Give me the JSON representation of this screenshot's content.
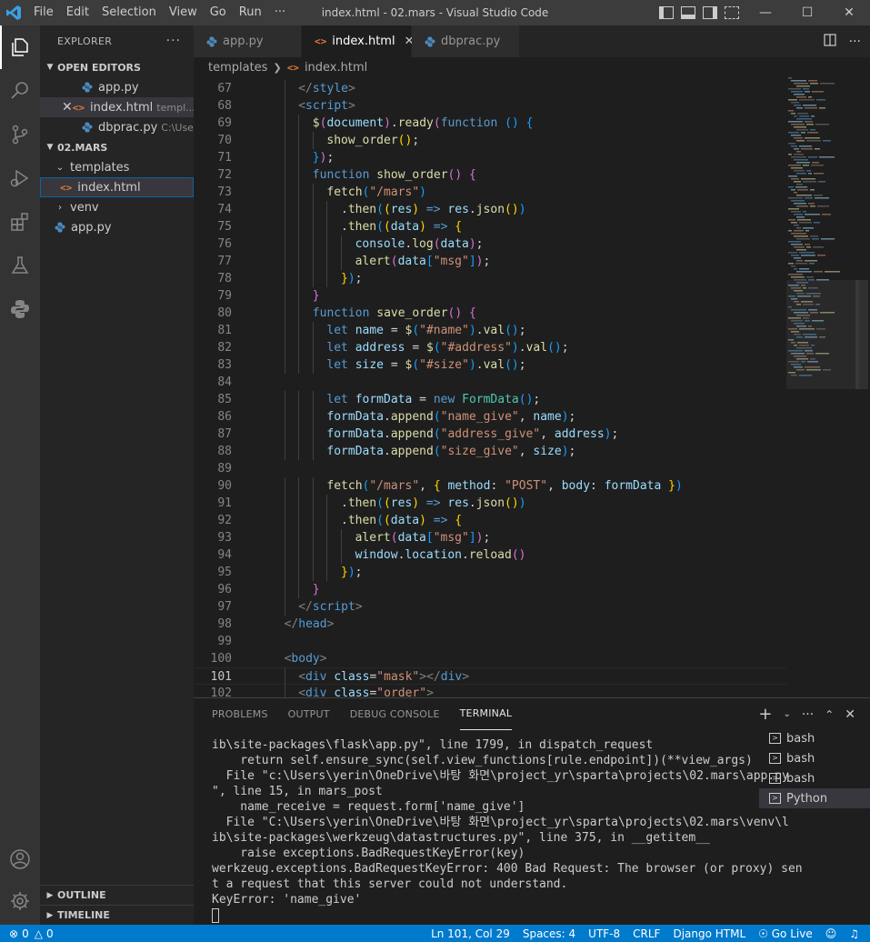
{
  "titlebar": {
    "menu": [
      "File",
      "Edit",
      "Selection",
      "View",
      "Go",
      "Run",
      "···"
    ],
    "title": "index.html - 02.mars - Visual Studio Code"
  },
  "sidebar": {
    "header": "EXPLORER",
    "open_editors_title": "OPEN EDITORS",
    "open_editors": [
      {
        "name": "app.py",
        "desc": "",
        "type": "py"
      },
      {
        "name": "index.html",
        "desc": "templ...",
        "type": "html"
      },
      {
        "name": "dbprac.py",
        "desc": "C:\\Use...",
        "type": "py"
      }
    ],
    "workspace_title": "02.MARS",
    "tree": [
      {
        "name": "templates",
        "kind": "folder-open"
      },
      {
        "name": "index.html",
        "kind": "html"
      },
      {
        "name": "venv",
        "kind": "folder-closed"
      },
      {
        "name": "app.py",
        "kind": "py"
      }
    ],
    "outline": "OUTLINE",
    "timeline": "TIMELINE"
  },
  "tabs": [
    {
      "name": "app.py",
      "type": "py"
    },
    {
      "name": "index.html",
      "type": "html"
    },
    {
      "name": "dbprac.py",
      "type": "py"
    }
  ],
  "breadcrumb": [
    "templates",
    "index.html"
  ],
  "editor": {
    "current_line": 101,
    "lines": [
      {
        "n": 67,
        "i": 2,
        "t": [
          [
            "</",
            "punct"
          ],
          [
            "style",
            "tag"
          ],
          [
            ">",
            "punct"
          ]
        ]
      },
      {
        "n": 68,
        "i": 2,
        "t": [
          [
            "<",
            "punct"
          ],
          [
            "script",
            "tag"
          ],
          [
            ">",
            "punct"
          ]
        ]
      },
      {
        "n": 69,
        "i": 3,
        "t": [
          [
            "$",
            "fn"
          ],
          [
            "(",
            "br2"
          ],
          [
            "document",
            "var"
          ],
          [
            ")",
            "br2"
          ],
          [
            ".",
            "plain"
          ],
          [
            "ready",
            "fn"
          ],
          [
            "(",
            "br2"
          ],
          [
            "function",
            "kw"
          ],
          [
            " ",
            "plain"
          ],
          [
            "()",
            "br3"
          ],
          [
            " ",
            "plain"
          ],
          [
            "{",
            "br3"
          ]
        ]
      },
      {
        "n": 70,
        "i": 4,
        "t": [
          [
            "show_order",
            "fn"
          ],
          [
            "()",
            "br1"
          ],
          [
            ";",
            "plain"
          ]
        ]
      },
      {
        "n": 71,
        "i": 3,
        "t": [
          [
            "}",
            "br3"
          ],
          [
            ")",
            "br2"
          ],
          [
            ";",
            "plain"
          ]
        ]
      },
      {
        "n": 72,
        "i": 3,
        "t": [
          [
            "function",
            "kw"
          ],
          [
            " ",
            "plain"
          ],
          [
            "show_order",
            "fn"
          ],
          [
            "()",
            "br2"
          ],
          [
            " ",
            "plain"
          ],
          [
            "{",
            "br2"
          ]
        ]
      },
      {
        "n": 73,
        "i": 4,
        "t": [
          [
            "fetch",
            "fn"
          ],
          [
            "(",
            "br3"
          ],
          [
            "\"/mars\"",
            "str"
          ],
          [
            ")",
            "br3"
          ]
        ]
      },
      {
        "n": 74,
        "i": 5,
        "t": [
          [
            ".",
            "plain"
          ],
          [
            "then",
            "fn"
          ],
          [
            "(",
            "br3"
          ],
          [
            "(",
            "br1"
          ],
          [
            "res",
            "var"
          ],
          [
            ")",
            "br1"
          ],
          [
            " => ",
            "kw"
          ],
          [
            "res",
            "var"
          ],
          [
            ".",
            "plain"
          ],
          [
            "json",
            "fn"
          ],
          [
            "()",
            "br1"
          ],
          [
            ")",
            "br3"
          ]
        ]
      },
      {
        "n": 75,
        "i": 5,
        "t": [
          [
            ".",
            "plain"
          ],
          [
            "then",
            "fn"
          ],
          [
            "(",
            "br3"
          ],
          [
            "(",
            "br1"
          ],
          [
            "data",
            "var"
          ],
          [
            ")",
            "br1"
          ],
          [
            " => ",
            "kw"
          ],
          [
            "{",
            "br1"
          ]
        ]
      },
      {
        "n": 76,
        "i": 6,
        "t": [
          [
            "console",
            "var"
          ],
          [
            ".",
            "plain"
          ],
          [
            "log",
            "fn"
          ],
          [
            "(",
            "br2"
          ],
          [
            "data",
            "var"
          ],
          [
            ")",
            "br2"
          ],
          [
            ";",
            "plain"
          ]
        ]
      },
      {
        "n": 77,
        "i": 6,
        "t": [
          [
            "alert",
            "fn"
          ],
          [
            "(",
            "br2"
          ],
          [
            "data",
            "var"
          ],
          [
            "[",
            "br3"
          ],
          [
            "\"msg\"",
            "str"
          ],
          [
            "]",
            "br3"
          ],
          [
            ")",
            "br2"
          ],
          [
            ";",
            "plain"
          ]
        ]
      },
      {
        "n": 78,
        "i": 5,
        "t": [
          [
            "}",
            "br1"
          ],
          [
            ")",
            "br3"
          ],
          [
            ";",
            "plain"
          ]
        ]
      },
      {
        "n": 79,
        "i": 3,
        "t": [
          [
            "}",
            "br2"
          ]
        ]
      },
      {
        "n": 80,
        "i": 3,
        "t": [
          [
            "function",
            "kw"
          ],
          [
            " ",
            "plain"
          ],
          [
            "save_order",
            "fn"
          ],
          [
            "()",
            "br2"
          ],
          [
            " ",
            "plain"
          ],
          [
            "{",
            "br2"
          ]
        ]
      },
      {
        "n": 81,
        "i": 4,
        "t": [
          [
            "let",
            "kw"
          ],
          [
            " ",
            "plain"
          ],
          [
            "name",
            "var"
          ],
          [
            " = ",
            "plain"
          ],
          [
            "$",
            "fn"
          ],
          [
            "(",
            "br3"
          ],
          [
            "\"#name\"",
            "str"
          ],
          [
            ")",
            "br3"
          ],
          [
            ".",
            "plain"
          ],
          [
            "val",
            "fn"
          ],
          [
            "()",
            "br3"
          ],
          [
            ";",
            "plain"
          ]
        ]
      },
      {
        "n": 82,
        "i": 4,
        "t": [
          [
            "let",
            "kw"
          ],
          [
            " ",
            "plain"
          ],
          [
            "address",
            "var"
          ],
          [
            " = ",
            "plain"
          ],
          [
            "$",
            "fn"
          ],
          [
            "(",
            "br3"
          ],
          [
            "\"#address\"",
            "str"
          ],
          [
            ")",
            "br3"
          ],
          [
            ".",
            "plain"
          ],
          [
            "val",
            "fn"
          ],
          [
            "()",
            "br3"
          ],
          [
            ";",
            "plain"
          ]
        ]
      },
      {
        "n": 83,
        "i": 4,
        "t": [
          [
            "let",
            "kw"
          ],
          [
            " ",
            "plain"
          ],
          [
            "size",
            "var"
          ],
          [
            " = ",
            "plain"
          ],
          [
            "$",
            "fn"
          ],
          [
            "(",
            "br3"
          ],
          [
            "\"#size\"",
            "str"
          ],
          [
            ")",
            "br3"
          ],
          [
            ".",
            "plain"
          ],
          [
            "val",
            "fn"
          ],
          [
            "()",
            "br3"
          ],
          [
            ";",
            "plain"
          ]
        ]
      },
      {
        "n": 84,
        "i": 0,
        "t": []
      },
      {
        "n": 85,
        "i": 4,
        "t": [
          [
            "let",
            "kw"
          ],
          [
            " ",
            "plain"
          ],
          [
            "formData",
            "var"
          ],
          [
            " = ",
            "plain"
          ],
          [
            "new",
            "kw"
          ],
          [
            " ",
            "plain"
          ],
          [
            "FormData",
            "cls"
          ],
          [
            "()",
            "br3"
          ],
          [
            ";",
            "plain"
          ]
        ]
      },
      {
        "n": 86,
        "i": 4,
        "t": [
          [
            "formData",
            "var"
          ],
          [
            ".",
            "plain"
          ],
          [
            "append",
            "fn"
          ],
          [
            "(",
            "br3"
          ],
          [
            "\"name_give\"",
            "str"
          ],
          [
            ", ",
            "plain"
          ],
          [
            "name",
            "var"
          ],
          [
            ")",
            "br3"
          ],
          [
            ";",
            "plain"
          ]
        ]
      },
      {
        "n": 87,
        "i": 4,
        "t": [
          [
            "formData",
            "var"
          ],
          [
            ".",
            "plain"
          ],
          [
            "append",
            "fn"
          ],
          [
            "(",
            "br3"
          ],
          [
            "\"address_give\"",
            "str"
          ],
          [
            ", ",
            "plain"
          ],
          [
            "address",
            "var"
          ],
          [
            ")",
            "br3"
          ],
          [
            ";",
            "plain"
          ]
        ]
      },
      {
        "n": 88,
        "i": 4,
        "t": [
          [
            "formData",
            "var"
          ],
          [
            ".",
            "plain"
          ],
          [
            "append",
            "fn"
          ],
          [
            "(",
            "br3"
          ],
          [
            "\"size_give\"",
            "str"
          ],
          [
            ", ",
            "plain"
          ],
          [
            "size",
            "var"
          ],
          [
            ")",
            "br3"
          ],
          [
            ";",
            "plain"
          ]
        ]
      },
      {
        "n": 89,
        "i": 0,
        "t": []
      },
      {
        "n": 90,
        "i": 4,
        "t": [
          [
            "fetch",
            "fn"
          ],
          [
            "(",
            "br3"
          ],
          [
            "\"/mars\"",
            "str"
          ],
          [
            ", ",
            "plain"
          ],
          [
            "{",
            "br1"
          ],
          [
            " ",
            "plain"
          ],
          [
            "method",
            "var"
          ],
          [
            ": ",
            "plain"
          ],
          [
            "\"POST\"",
            "str"
          ],
          [
            ", ",
            "plain"
          ],
          [
            "body",
            "var"
          ],
          [
            ": ",
            "plain"
          ],
          [
            "formData",
            "var"
          ],
          [
            " ",
            "plain"
          ],
          [
            "}",
            "br1"
          ],
          [
            ")",
            "br3"
          ]
        ]
      },
      {
        "n": 91,
        "i": 5,
        "t": [
          [
            ".",
            "plain"
          ],
          [
            "then",
            "fn"
          ],
          [
            "(",
            "br3"
          ],
          [
            "(",
            "br1"
          ],
          [
            "res",
            "var"
          ],
          [
            ")",
            "br1"
          ],
          [
            " => ",
            "kw"
          ],
          [
            "res",
            "var"
          ],
          [
            ".",
            "plain"
          ],
          [
            "json",
            "fn"
          ],
          [
            "()",
            "br1"
          ],
          [
            ")",
            "br3"
          ]
        ]
      },
      {
        "n": 92,
        "i": 5,
        "t": [
          [
            ".",
            "plain"
          ],
          [
            "then",
            "fn"
          ],
          [
            "(",
            "br3"
          ],
          [
            "(",
            "br1"
          ],
          [
            "data",
            "var"
          ],
          [
            ")",
            "br1"
          ],
          [
            " => ",
            "kw"
          ],
          [
            "{",
            "br1"
          ]
        ]
      },
      {
        "n": 93,
        "i": 6,
        "t": [
          [
            "alert",
            "fn"
          ],
          [
            "(",
            "br2"
          ],
          [
            "data",
            "var"
          ],
          [
            "[",
            "br3"
          ],
          [
            "\"msg\"",
            "str"
          ],
          [
            "]",
            "br3"
          ],
          [
            ")",
            "br2"
          ],
          [
            ";",
            "plain"
          ]
        ]
      },
      {
        "n": 94,
        "i": 6,
        "t": [
          [
            "window",
            "var"
          ],
          [
            ".",
            "plain"
          ],
          [
            "location",
            "var"
          ],
          [
            ".",
            "plain"
          ],
          [
            "reload",
            "fn"
          ],
          [
            "()",
            "br2"
          ]
        ]
      },
      {
        "n": 95,
        "i": 5,
        "t": [
          [
            "}",
            "br1"
          ],
          [
            ")",
            "br3"
          ],
          [
            ";",
            "plain"
          ]
        ]
      },
      {
        "n": 96,
        "i": 3,
        "t": [
          [
            "}",
            "br2"
          ]
        ]
      },
      {
        "n": 97,
        "i": 2,
        "t": [
          [
            "</",
            "punct"
          ],
          [
            "script",
            "tag"
          ],
          [
            ">",
            "punct"
          ]
        ]
      },
      {
        "n": 98,
        "i": 1,
        "t": [
          [
            "</",
            "punct"
          ],
          [
            "head",
            "tag"
          ],
          [
            ">",
            "punct"
          ]
        ]
      },
      {
        "n": 99,
        "i": 0,
        "t": []
      },
      {
        "n": 100,
        "i": 1,
        "t": [
          [
            "<",
            "punct"
          ],
          [
            "body",
            "tag"
          ],
          [
            ">",
            "punct"
          ]
        ]
      },
      {
        "n": 101,
        "i": 2,
        "t": [
          [
            "<",
            "punct"
          ],
          [
            "div",
            "tag"
          ],
          [
            " ",
            "plain"
          ],
          [
            "class",
            "attr"
          ],
          [
            "=",
            "plain"
          ],
          [
            "\"mask\"",
            "str"
          ],
          [
            ">",
            "punct"
          ],
          [
            "</",
            "punct"
          ],
          [
            "div",
            "tag"
          ],
          [
            ">",
            "punct"
          ]
        ]
      },
      {
        "n": 102,
        "i": 2,
        "t": [
          [
            "<",
            "punct"
          ],
          [
            "div",
            "tag"
          ],
          [
            " ",
            "plain"
          ],
          [
            "class",
            "attr"
          ],
          [
            "=",
            "plain"
          ],
          [
            "\"order\"",
            "str"
          ],
          [
            ">",
            "punct"
          ]
        ]
      }
    ]
  },
  "panel": {
    "tabs": [
      "PROBLEMS",
      "OUTPUT",
      "DEBUG CONSOLE",
      "TERMINAL"
    ],
    "active_tab": "TERMINAL",
    "terminal_lines": [
      "ib\\site-packages\\flask\\app.py\", line 1799, in dispatch_request",
      "    return self.ensure_sync(self.view_functions[rule.endpoint])(**view_args)",
      "  File \"c:\\Users\\yerin\\OneDrive\\바탕 화면\\project_yr\\sparta\\projects\\02.mars\\app.py",
      "\", line 15, in mars_post",
      "    name_receive = request.form['name_give']",
      "  File \"C:\\Users\\yerin\\OneDrive\\바탕 화면\\project_yr\\sparta\\projects\\02.mars\\venv\\l",
      "ib\\site-packages\\werkzeug\\datastructures.py\", line 375, in __getitem__",
      "    raise exceptions.BadRequestKeyError(key)",
      "werkzeug.exceptions.BadRequestKeyError: 400 Bad Request: The browser (or proxy) sen",
      "t a request that this server could not understand.",
      "KeyError: 'name_give'"
    ],
    "terminals": [
      "bash",
      "bash",
      "bash",
      "Python"
    ],
    "active_terminal": 3
  },
  "statusbar": {
    "errors": "0",
    "warnings": "0",
    "items": [
      "Ln 101, Col 29",
      "Spaces: 4",
      "UTF-8",
      "CRLF",
      "Django HTML",
      "Go Live"
    ]
  },
  "colors": {
    "accent": "#007acc",
    "editor_bg": "#1e1e1e",
    "sidebar_bg": "#252526",
    "activity_bg": "#333333"
  }
}
